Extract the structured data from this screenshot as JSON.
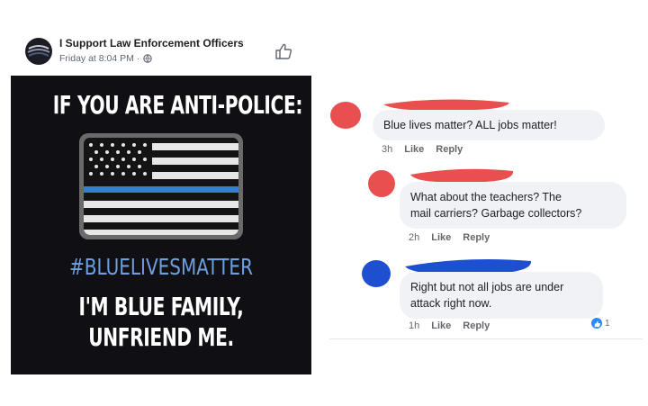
{
  "post": {
    "page_name": "I Support Law Enforcement Officers",
    "timestamp": "Friday at 8:04 PM ·",
    "icons": {
      "avatar": "avatar",
      "privacy": "globe-icon",
      "reaction": "like-icon"
    },
    "meme": {
      "top_text": "IF YOU ARE ANTI-POLICE:",
      "hashtag": "#BLUELIVESMATTER",
      "bottom_line1": "I'M BLUE FAMILY,",
      "bottom_line2": "UNFRIEND ME.",
      "flag_icon": "thin-blue-line-flag-icon"
    }
  },
  "comments": [
    {
      "text": "Blue lives matter? ALL jobs matter!",
      "time": "3h",
      "like_label": "Like",
      "reply_label": "Reply",
      "redaction_color": "#e8504f"
    },
    {
      "text_line1": "What about the teachers? The",
      "text_line2": "mail carriers? Garbage collectors?",
      "time": "2h",
      "like_label": "Like",
      "reply_label": "Reply",
      "redaction_color": "#e8504f"
    },
    {
      "text_line1": "Right but not all jobs are under",
      "text_line2": "attack right now.",
      "time": "1h",
      "like_label": "Like",
      "reply_label": "Reply",
      "reaction_count": "1",
      "redaction_color": "#1f4fd1"
    }
  ],
  "colors": {
    "hashtag_blue": "#6e9fe0",
    "thin_blue_line": "#3a7bd5",
    "link_gray": "#65676b"
  }
}
